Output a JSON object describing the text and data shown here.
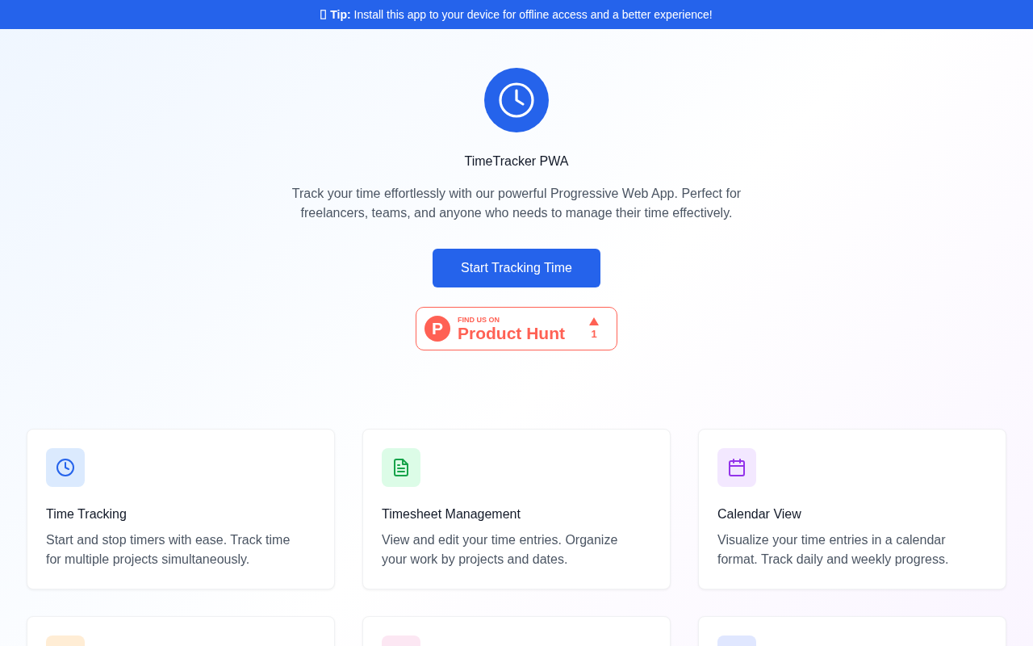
{
  "banner": {
    "text": "**Tip:** Install this app to your device for offline access and a better experience!"
  },
  "hero": {
    "title": "TimeTracker PWA",
    "description": "Track your time effortlessly with our powerful Progressive Web App. Perfect for freelancers, teams, and anyone who needs to manage their time effectively.",
    "cta_button": "Start Tracking Time",
    "product_hunt_badge": {
      "logo_letter": "P",
      "caption": "FIND US ON",
      "name": "Product Hunt",
      "upvotes": "1"
    }
  },
  "features": [
    {
      "title": "Time Tracking",
      "description": "Start and stop timers with ease. Track time for multiple projects simultaneously.",
      "color": "#dbeafe"
    },
    {
      "title": "Timesheet Management",
      "description": "View and edit your time entries. Organize your work by projects and dates.",
      "color": "#dcfce7"
    },
    {
      "title": "Calendar View",
      "description": "Visualize your time entries in a calendar format. Track daily and weekly progress.",
      "color": "#f3e8ff"
    },
    {
      "color": "#ffedd5"
    },
    {
      "color": "#fce7f3"
    },
    {
      "color": "#e0e7ff"
    }
  ]
}
